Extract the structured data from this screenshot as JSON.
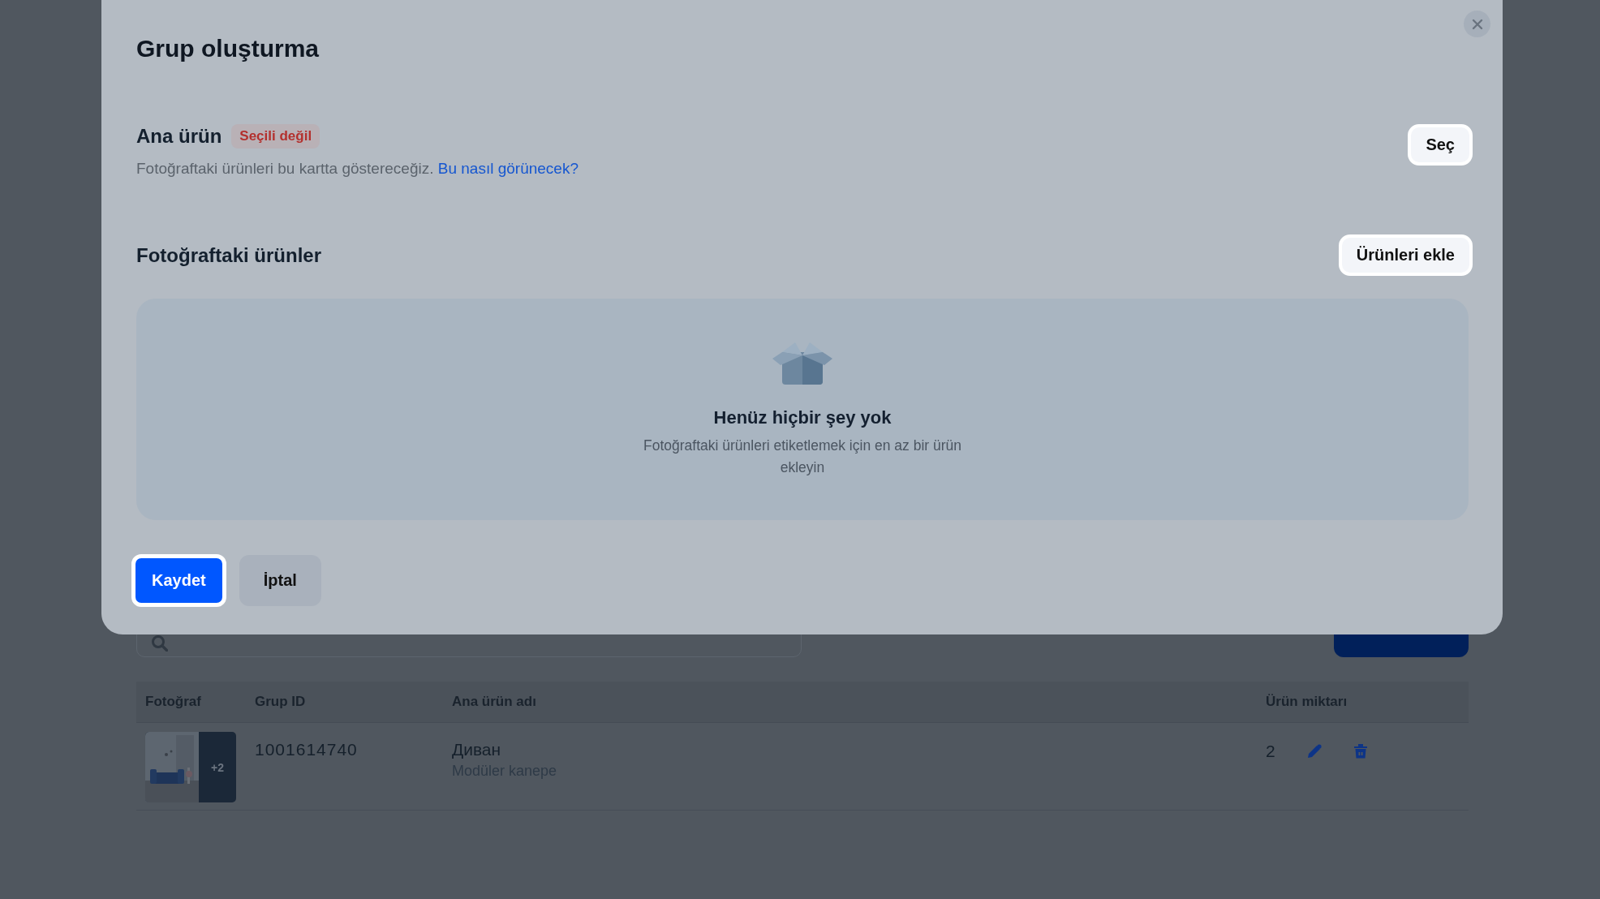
{
  "dialog": {
    "title": "Grup oluşturma",
    "main_product": {
      "label": "Ana ürün",
      "badge": "Seçili değil",
      "description": "Fotoğraftaki ürünleri bu kartta göstereceğiz.",
      "link": "Bu nasıl görünecek?",
      "button": "Seç"
    },
    "photo_products": {
      "label": "Fotoğraftaki ürünler",
      "button": "Ürünleri ekle",
      "empty_title": "Henüz hiçbir şey yok",
      "empty_text": "Fotoğraftaki ürünleri etiketlemek için en az bir ürün ekleyin"
    },
    "actions": [
      {
        "label": "Kaydet",
        "kind": "primary"
      },
      {
        "label": "İptal",
        "kind": "secondary"
      }
    ]
  },
  "table": {
    "columns": [
      "Fotoğraf",
      "Grup ID",
      "Ana ürün adı",
      "Ürün miktarı"
    ],
    "rows": [
      {
        "photo": {
          "kind": "picture",
          "more": "+2"
        },
        "group_id": "1001614740",
        "name": "Диван",
        "subtitle": "Modüler kanepe",
        "quantity": "2"
      }
    ]
  }
}
